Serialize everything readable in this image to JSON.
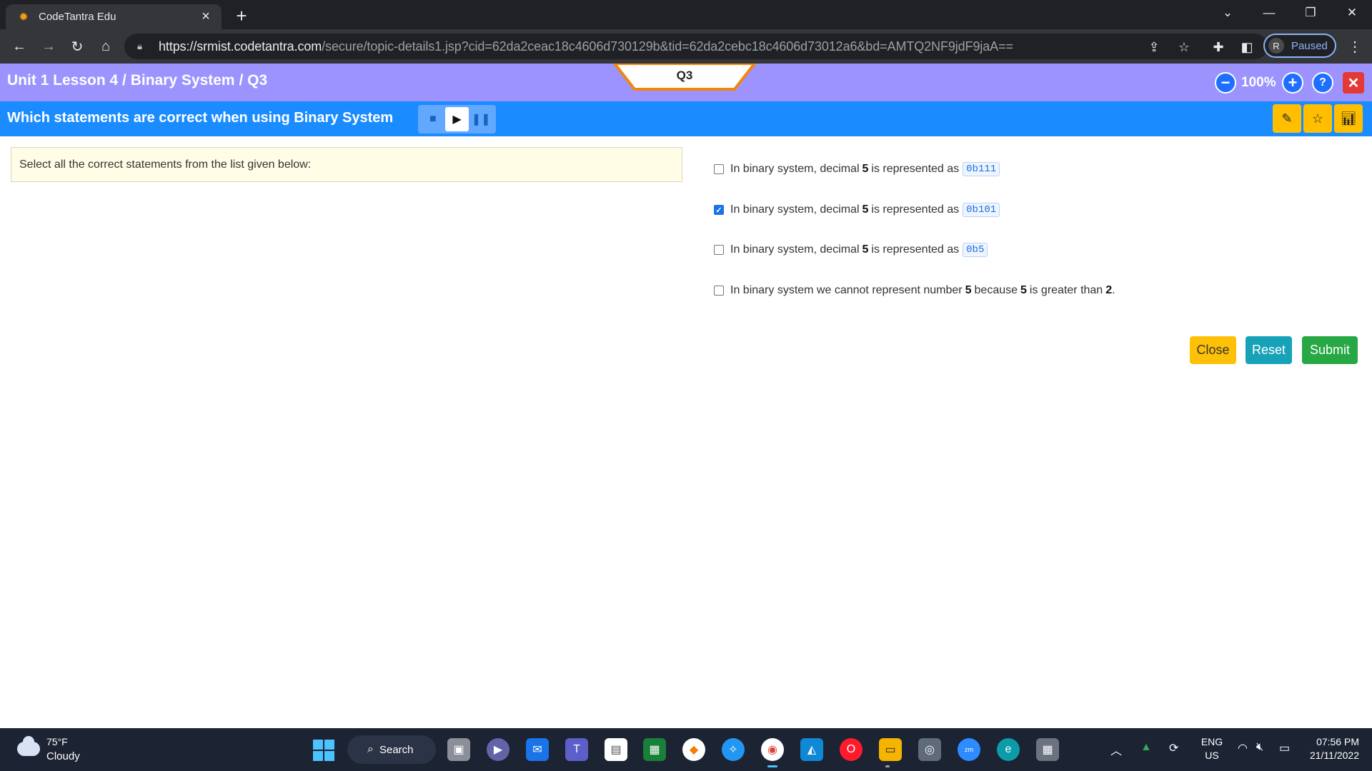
{
  "browser": {
    "tab_title": "CodeTantra Edu",
    "url_host": "https://srmist.codetantra.com",
    "url_path": "/secure/topic-details1.jsp?cid=62da2ceac18c4606d730129b&tid=62da2cebc18c4606d73012a6&bd=AMTQ2NF9jdF9jaA==",
    "profile_initial": "R",
    "profile_status": "Paused"
  },
  "header": {
    "breadcrumb": "Unit 1 Lesson 4 / Binary System / Q3",
    "question_tab": "Q3",
    "zoom_level": "100%"
  },
  "question": {
    "title": "Which statements are correct when using Binary System",
    "instruction": "Select all the correct statements from the list given below:",
    "options": [
      {
        "prefix": "In binary system, decimal ",
        "bold": "5",
        "middle": " is represented as",
        "code": "0b111",
        "checked": false
      },
      {
        "prefix": "In binary system, decimal ",
        "bold": "5",
        "middle": " is represented as",
        "code": "0b101",
        "checked": true
      },
      {
        "prefix": "In binary system, decimal ",
        "bold": "5",
        "middle": " is represented as",
        "code": "0b5",
        "checked": false
      },
      {
        "prefix": "In binary system we cannot represent number ",
        "bold": "5",
        "middle": " because ",
        "bold2": "5",
        "suffix": " is greater than ",
        "bold3": "2",
        "end": ".",
        "checked": false
      }
    ]
  },
  "actions": {
    "close_label": "Close",
    "reset_label": "Reset",
    "submit_label": "Submit",
    "colors": {
      "close": "#ffc107",
      "reset": "#17a2b8",
      "submit": "#28a745"
    }
  },
  "colors": {
    "header_bg": "#9c93ff",
    "question_bar_bg": "#1a8cff",
    "tab_accent": "#f0860a"
  },
  "taskbar": {
    "weather_temp": "75°F",
    "weather_desc": "Cloudy",
    "search_label": "Search",
    "lang_top": "ENG",
    "lang_bottom": "US",
    "time": "07:56 PM",
    "date": "21/11/2022"
  }
}
